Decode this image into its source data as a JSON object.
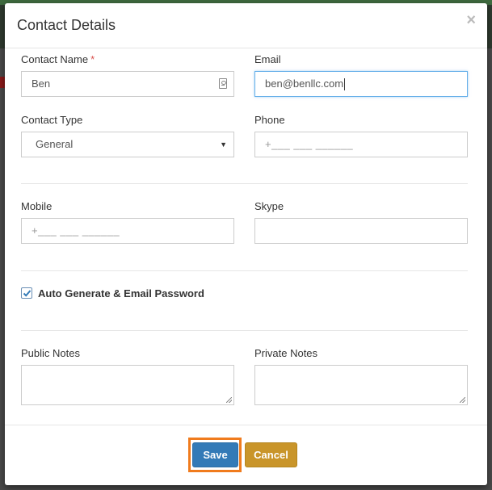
{
  "modal": {
    "title": "Contact Details",
    "close_glyph": "×"
  },
  "form": {
    "contact_name": {
      "label": "Contact Name",
      "required_mark": "*",
      "value": "Ben"
    },
    "email": {
      "label": "Email",
      "value": "ben@benllc.com"
    },
    "contact_type": {
      "label": "Contact Type",
      "selected": "General"
    },
    "phone": {
      "label": "Phone",
      "placeholder": "+___ ___ ______"
    },
    "mobile": {
      "label": "Mobile",
      "placeholder": "+___ ___ ______"
    },
    "skype": {
      "label": "Skype",
      "value": ""
    },
    "auto_generate": {
      "label": "Auto Generate & Email Password",
      "checked": true
    },
    "public_notes": {
      "label": "Public Notes"
    },
    "private_notes": {
      "label": "Private Notes"
    }
  },
  "footer": {
    "save_label": "Save",
    "cancel_label": "Cancel"
  },
  "colors": {
    "primary": "#337ab7",
    "cancel": "#c9952a",
    "highlight": "#f07b1d",
    "required": "#d9534f"
  },
  "icons": {
    "contact_name_field": "contact-card-icon",
    "select": "caret-down-icon",
    "checkbox": "checkmark-icon",
    "close": "close-icon"
  }
}
